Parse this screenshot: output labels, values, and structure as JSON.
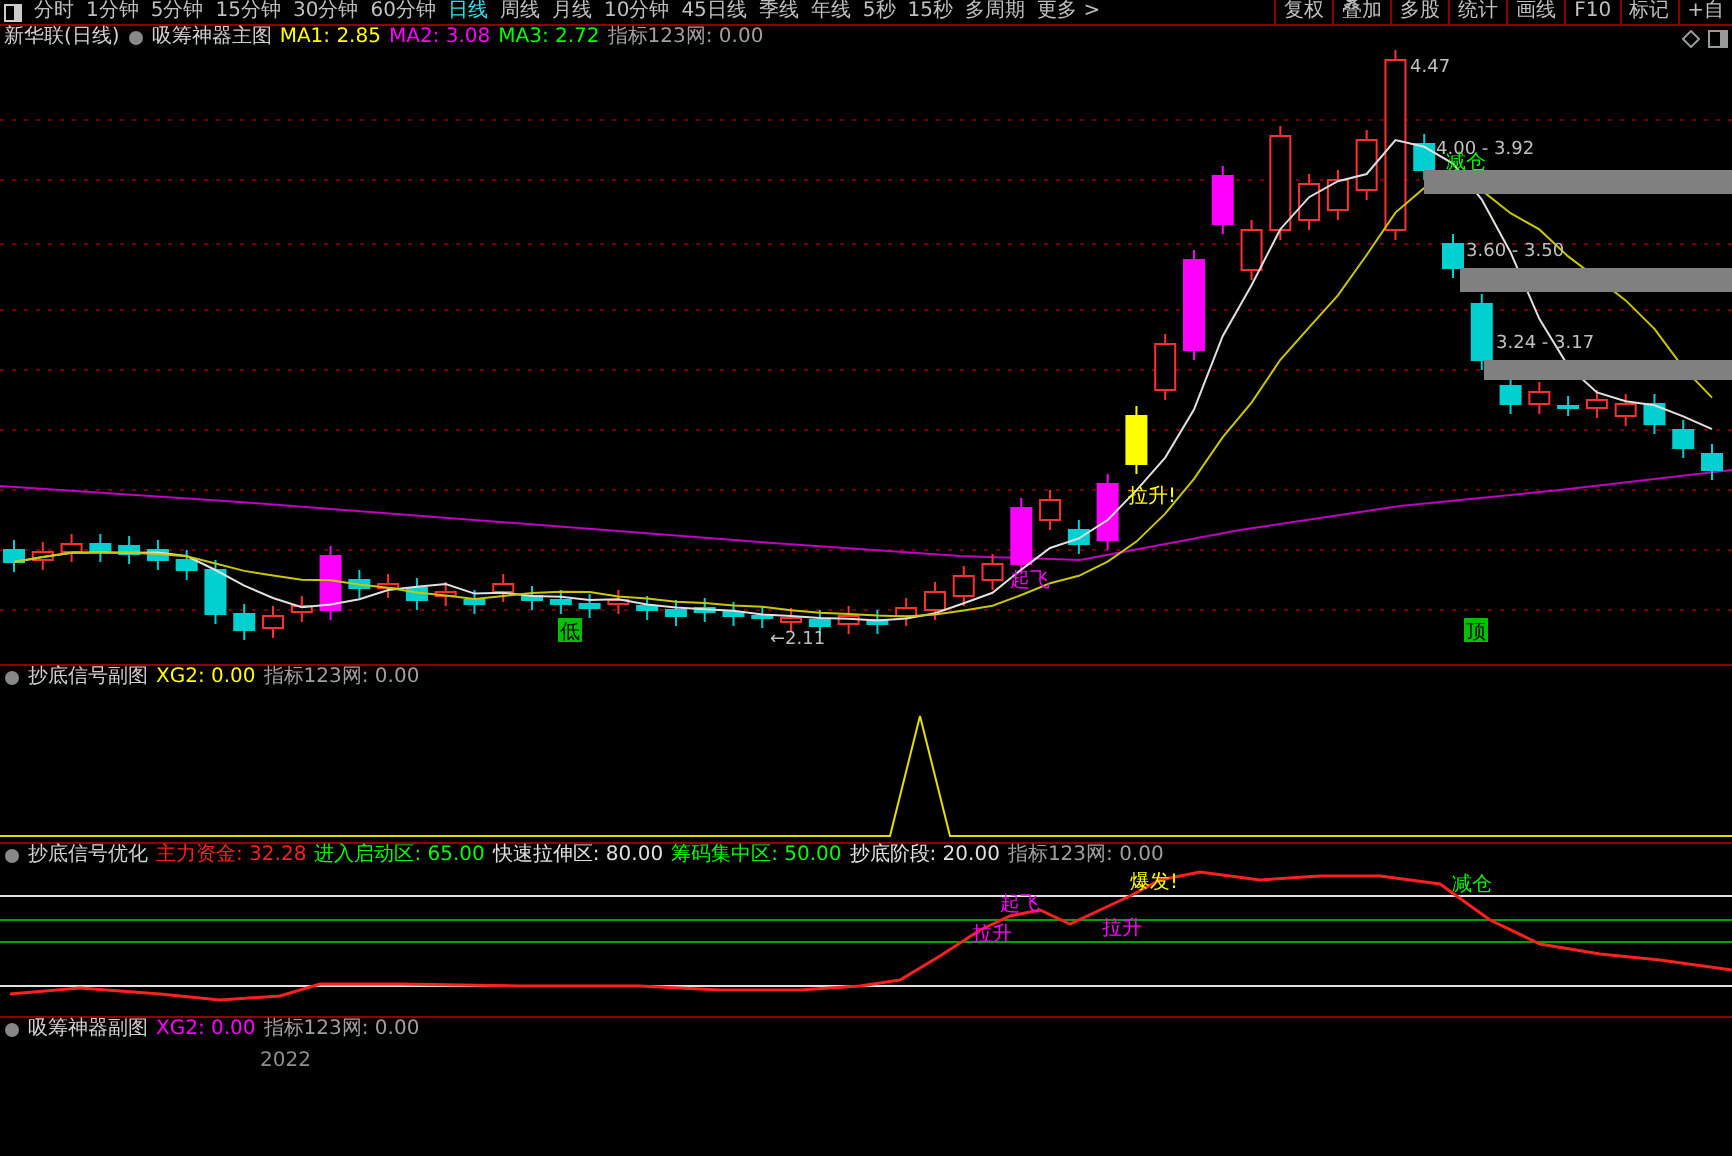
{
  "toolbar": {
    "periods": [
      {
        "label": "分时",
        "selected": false
      },
      {
        "label": "1分钟",
        "selected": false
      },
      {
        "label": "5分钟",
        "selected": false
      },
      {
        "label": "15分钟",
        "selected": false
      },
      {
        "label": "30分钟",
        "selected": false
      },
      {
        "label": "60分钟",
        "selected": false
      },
      {
        "label": "日线",
        "selected": true
      },
      {
        "label": "周线",
        "selected": false
      },
      {
        "label": "月线",
        "selected": false
      },
      {
        "label": "10分钟",
        "selected": false
      },
      {
        "label": "45日线",
        "selected": false
      },
      {
        "label": "季线",
        "selected": false
      },
      {
        "label": "年线",
        "selected": false
      },
      {
        "label": "5秒",
        "selected": false
      },
      {
        "label": "15秒",
        "selected": false
      },
      {
        "label": "多周期",
        "selected": false
      },
      {
        "label": "更多 >",
        "selected": false
      }
    ],
    "actions": [
      "复权",
      "叠加",
      "多股",
      "统计",
      "画线",
      "F10",
      "标记",
      "+自"
    ]
  },
  "main_panel": {
    "title": "新华联(日线)",
    "indicator": "吸筹神器主图",
    "values": [
      {
        "label": "MA1: 2.85",
        "color": "#ffff00"
      },
      {
        "label": "MA2: 3.08",
        "color": "#ff00ff"
      },
      {
        "label": "MA3: 2.72",
        "color": "#00ff00"
      },
      {
        "label": "指标123网: 0.00",
        "color": "#a0a0a0"
      }
    ],
    "annotations": [
      {
        "kind": "price",
        "text": "4.47",
        "color": "#c0c0c0"
      },
      {
        "kind": "price",
        "text": "4.00 - 3.92",
        "color": "#c0c0c0"
      },
      {
        "kind": "price",
        "text": "3.60 - 3.50",
        "color": "#c0c0c0"
      },
      {
        "kind": "price",
        "text": "3.24 - 3.17",
        "color": "#c0c0c0"
      },
      {
        "kind": "price",
        "text": "←2.11",
        "color": "#c0c0c0"
      },
      {
        "kind": "signal",
        "text": "减仓",
        "color": "#00ff00"
      },
      {
        "kind": "signal",
        "text": "拉升!",
        "color": "#ffff00"
      },
      {
        "kind": "signal",
        "text": "起飞",
        "color": "#ff00ff"
      },
      {
        "kind": "marker",
        "text": "低",
        "color": "#00c000"
      },
      {
        "kind": "marker",
        "text": "顶",
        "color": "#00c000"
      }
    ]
  },
  "signal_panel": {
    "title": "抄底信号副图",
    "values": [
      {
        "label": "XG2: 0.00",
        "color": "#ffff00"
      },
      {
        "label": "指标123网: 0.00",
        "color": "#a0a0a0"
      }
    ]
  },
  "optimize_panel": {
    "title": "抄底信号优化",
    "values": [
      {
        "label": "主力资金: 32.28",
        "color": "#ff2020"
      },
      {
        "label": "进入启动区: 65.00",
        "color": "#00ff00"
      },
      {
        "label": "快速拉伸区: 80.00",
        "color": "#e0e0e0"
      },
      {
        "label": "筹码集中区: 50.00",
        "color": "#00ff00"
      },
      {
        "label": "抄底阶段: 20.00",
        "color": "#e0e0e0"
      },
      {
        "label": "指标123网: 0.00",
        "color": "#a0a0a0"
      }
    ],
    "annotations": [
      {
        "text": "起飞",
        "color": "#ff00ff"
      },
      {
        "text": "拉升",
        "color": "#ff00ff"
      },
      {
        "text": "爆发!",
        "color": "#ffff00"
      },
      {
        "text": "拉升",
        "color": "#ff00ff"
      },
      {
        "text": "减仓",
        "color": "#00ff00"
      }
    ]
  },
  "accumulate_panel": {
    "title": "吸筹神器副图",
    "values": [
      {
        "label": "XG2: 0.00",
        "color": "#ff00ff"
      },
      {
        "label": "指标123网: 0.00",
        "color": "#a0a0a0"
      }
    ],
    "year_label": "2022"
  }
}
